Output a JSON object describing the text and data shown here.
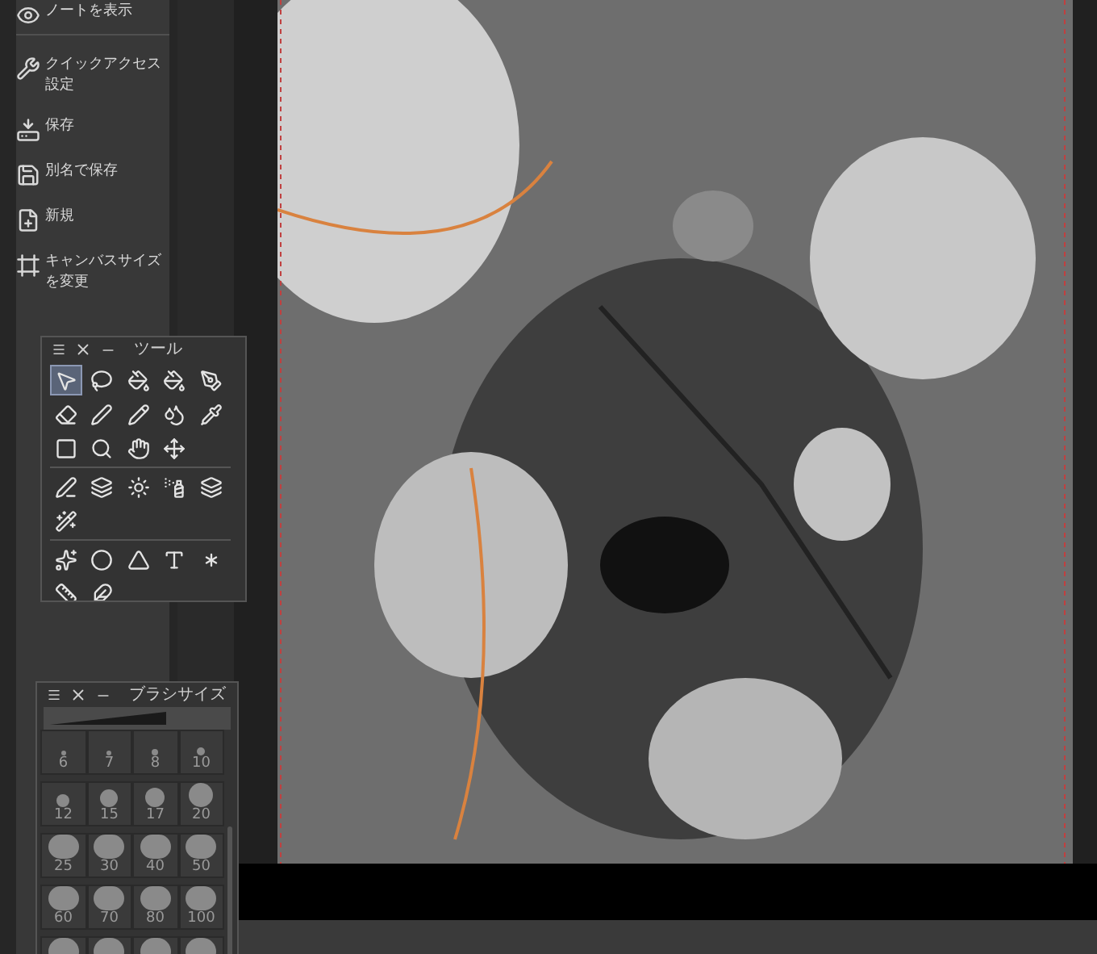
{
  "sidebar": {
    "items": [
      {
        "label": "ノートを表示"
      },
      {
        "label": "クイックアクセス設定"
      },
      {
        "label": "保存"
      },
      {
        "label": "別名で保存"
      },
      {
        "label": "新規"
      },
      {
        "label": "キャンバスサイズを変更"
      }
    ]
  },
  "tool_palette": {
    "title": "ツール",
    "groups": [
      {
        "tools": [
          {
            "selected": true
          },
          {
            "selected": false
          },
          {
            "selected": false
          },
          {
            "selected": false
          },
          {
            "selected": false
          },
          {
            "selected": false
          },
          {
            "selected": false
          },
          {
            "selected": false
          },
          {
            "selected": false
          },
          {
            "selected": false
          },
          {
            "selected": false
          },
          {
            "selected": false
          },
          {
            "selected": false
          },
          {
            "selected": false
          }
        ]
      },
      {
        "tools": [
          {
            "selected": false
          },
          {
            "selected": false
          },
          {
            "selected": false
          },
          {
            "selected": false
          },
          {
            "selected": false
          },
          {
            "selected": false
          }
        ]
      },
      {
        "tools": [
          {
            "selected": false
          },
          {
            "selected": false
          },
          {
            "selected": false
          },
          {
            "selected": false
          },
          {
            "selected": false
          },
          {
            "selected": false
          },
          {
            "selected": false
          }
        ]
      }
    ]
  },
  "brush_size_palette": {
    "title": "ブラシサイズ",
    "sizes": [
      {
        "label": "6"
      },
      {
        "label": "7"
      },
      {
        "label": "8"
      },
      {
        "label": "10"
      },
      {
        "label": "12"
      },
      {
        "label": "15"
      },
      {
        "label": "17"
      },
      {
        "label": "20"
      },
      {
        "label": "25"
      },
      {
        "label": "30"
      },
      {
        "label": "40"
      },
      {
        "label": "50"
      },
      {
        "label": "60"
      },
      {
        "label": "70"
      },
      {
        "label": "80"
      },
      {
        "label": "100"
      },
      {
        "kind": "cut"
      },
      {
        "kind": "cut"
      },
      {
        "kind": "cut"
      },
      {
        "kind": "cut"
      }
    ]
  }
}
